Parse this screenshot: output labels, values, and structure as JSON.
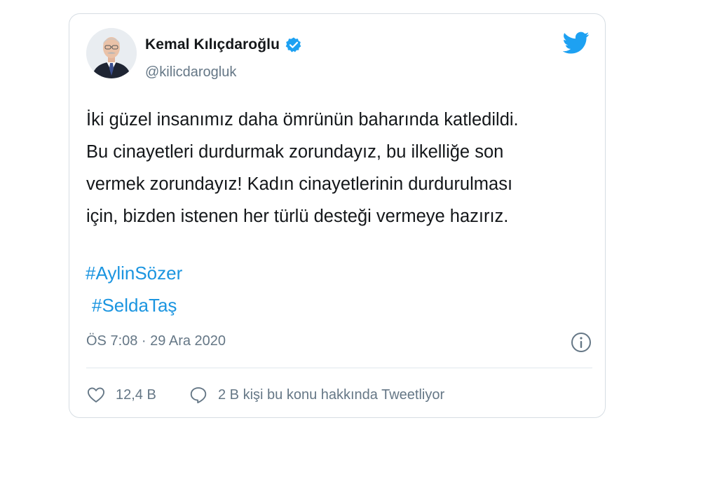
{
  "tweet": {
    "author": {
      "name": "Kemal Kılıçdaroğlu",
      "handle": "@kilicdarogluk",
      "verified": true
    },
    "text_lines": [
      "İki güzel insanımız daha ömrünün baharında katledildi.",
      "Bu cinayetleri durdurmak zorundayız, bu ilkelliğe son",
      "vermek zorundayız! Kadın cinayetlerinin durdurulması",
      "için, bizden istenen her türlü desteği vermeye hazırız."
    ],
    "hashtags": [
      "#AylinSözer",
      "#SeldaTaş"
    ],
    "timestamp": "ÖS 7:08 · 29 Ara 2020",
    "likes": "12,4 B",
    "conversation": "2 B kişi bu konu hakkında Tweetliyor"
  },
  "icons": {
    "brand": "twitter-bird-icon",
    "verified": "verified-badge-icon",
    "info": "info-icon",
    "like": "heart-icon",
    "reply": "reply-bubble-icon"
  },
  "colors": {
    "brand": "#1da1f2",
    "hashtag": "#1b95e0",
    "secondary_text": "#657786",
    "primary_text": "#14171a",
    "border": "#d6dde3"
  }
}
